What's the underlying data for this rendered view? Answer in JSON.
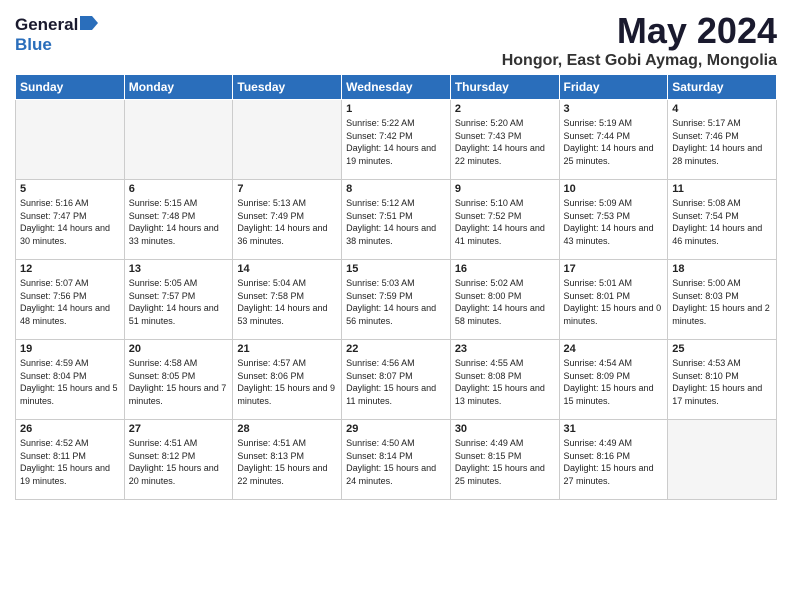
{
  "logo": {
    "general": "General",
    "blue": "Blue"
  },
  "title": {
    "month": "May 2024",
    "location": "Hongor, East Gobi Aymag, Mongolia"
  },
  "headers": [
    "Sunday",
    "Monday",
    "Tuesday",
    "Wednesday",
    "Thursday",
    "Friday",
    "Saturday"
  ],
  "weeks": [
    [
      {
        "day": "",
        "sunrise": "",
        "sunset": "",
        "daylight": "",
        "empty": true
      },
      {
        "day": "",
        "sunrise": "",
        "sunset": "",
        "daylight": "",
        "empty": true
      },
      {
        "day": "",
        "sunrise": "",
        "sunset": "",
        "daylight": "",
        "empty": true
      },
      {
        "day": "1",
        "sunrise": "Sunrise: 5:22 AM",
        "sunset": "Sunset: 7:42 PM",
        "daylight": "Daylight: 14 hours and 19 minutes."
      },
      {
        "day": "2",
        "sunrise": "Sunrise: 5:20 AM",
        "sunset": "Sunset: 7:43 PM",
        "daylight": "Daylight: 14 hours and 22 minutes."
      },
      {
        "day": "3",
        "sunrise": "Sunrise: 5:19 AM",
        "sunset": "Sunset: 7:44 PM",
        "daylight": "Daylight: 14 hours and 25 minutes."
      },
      {
        "day": "4",
        "sunrise": "Sunrise: 5:17 AM",
        "sunset": "Sunset: 7:46 PM",
        "daylight": "Daylight: 14 hours and 28 minutes."
      }
    ],
    [
      {
        "day": "5",
        "sunrise": "Sunrise: 5:16 AM",
        "sunset": "Sunset: 7:47 PM",
        "daylight": "Daylight: 14 hours and 30 minutes."
      },
      {
        "day": "6",
        "sunrise": "Sunrise: 5:15 AM",
        "sunset": "Sunset: 7:48 PM",
        "daylight": "Daylight: 14 hours and 33 minutes."
      },
      {
        "day": "7",
        "sunrise": "Sunrise: 5:13 AM",
        "sunset": "Sunset: 7:49 PM",
        "daylight": "Daylight: 14 hours and 36 minutes."
      },
      {
        "day": "8",
        "sunrise": "Sunrise: 5:12 AM",
        "sunset": "Sunset: 7:51 PM",
        "daylight": "Daylight: 14 hours and 38 minutes."
      },
      {
        "day": "9",
        "sunrise": "Sunrise: 5:10 AM",
        "sunset": "Sunset: 7:52 PM",
        "daylight": "Daylight: 14 hours and 41 minutes."
      },
      {
        "day": "10",
        "sunrise": "Sunrise: 5:09 AM",
        "sunset": "Sunset: 7:53 PM",
        "daylight": "Daylight: 14 hours and 43 minutes."
      },
      {
        "day": "11",
        "sunrise": "Sunrise: 5:08 AM",
        "sunset": "Sunset: 7:54 PM",
        "daylight": "Daylight: 14 hours and 46 minutes."
      }
    ],
    [
      {
        "day": "12",
        "sunrise": "Sunrise: 5:07 AM",
        "sunset": "Sunset: 7:56 PM",
        "daylight": "Daylight: 14 hours and 48 minutes."
      },
      {
        "day": "13",
        "sunrise": "Sunrise: 5:05 AM",
        "sunset": "Sunset: 7:57 PM",
        "daylight": "Daylight: 14 hours and 51 minutes."
      },
      {
        "day": "14",
        "sunrise": "Sunrise: 5:04 AM",
        "sunset": "Sunset: 7:58 PM",
        "daylight": "Daylight: 14 hours and 53 minutes."
      },
      {
        "day": "15",
        "sunrise": "Sunrise: 5:03 AM",
        "sunset": "Sunset: 7:59 PM",
        "daylight": "Daylight: 14 hours and 56 minutes."
      },
      {
        "day": "16",
        "sunrise": "Sunrise: 5:02 AM",
        "sunset": "Sunset: 8:00 PM",
        "daylight": "Daylight: 14 hours and 58 minutes."
      },
      {
        "day": "17",
        "sunrise": "Sunrise: 5:01 AM",
        "sunset": "Sunset: 8:01 PM",
        "daylight": "Daylight: 15 hours and 0 minutes."
      },
      {
        "day": "18",
        "sunrise": "Sunrise: 5:00 AM",
        "sunset": "Sunset: 8:03 PM",
        "daylight": "Daylight: 15 hours and 2 minutes."
      }
    ],
    [
      {
        "day": "19",
        "sunrise": "Sunrise: 4:59 AM",
        "sunset": "Sunset: 8:04 PM",
        "daylight": "Daylight: 15 hours and 5 minutes."
      },
      {
        "day": "20",
        "sunrise": "Sunrise: 4:58 AM",
        "sunset": "Sunset: 8:05 PM",
        "daylight": "Daylight: 15 hours and 7 minutes."
      },
      {
        "day": "21",
        "sunrise": "Sunrise: 4:57 AM",
        "sunset": "Sunset: 8:06 PM",
        "daylight": "Daylight: 15 hours and 9 minutes."
      },
      {
        "day": "22",
        "sunrise": "Sunrise: 4:56 AM",
        "sunset": "Sunset: 8:07 PM",
        "daylight": "Daylight: 15 hours and 11 minutes."
      },
      {
        "day": "23",
        "sunrise": "Sunrise: 4:55 AM",
        "sunset": "Sunset: 8:08 PM",
        "daylight": "Daylight: 15 hours and 13 minutes."
      },
      {
        "day": "24",
        "sunrise": "Sunrise: 4:54 AM",
        "sunset": "Sunset: 8:09 PM",
        "daylight": "Daylight: 15 hours and 15 minutes."
      },
      {
        "day": "25",
        "sunrise": "Sunrise: 4:53 AM",
        "sunset": "Sunset: 8:10 PM",
        "daylight": "Daylight: 15 hours and 17 minutes."
      }
    ],
    [
      {
        "day": "26",
        "sunrise": "Sunrise: 4:52 AM",
        "sunset": "Sunset: 8:11 PM",
        "daylight": "Daylight: 15 hours and 19 minutes."
      },
      {
        "day": "27",
        "sunrise": "Sunrise: 4:51 AM",
        "sunset": "Sunset: 8:12 PM",
        "daylight": "Daylight: 15 hours and 20 minutes."
      },
      {
        "day": "28",
        "sunrise": "Sunrise: 4:51 AM",
        "sunset": "Sunset: 8:13 PM",
        "daylight": "Daylight: 15 hours and 22 minutes."
      },
      {
        "day": "29",
        "sunrise": "Sunrise: 4:50 AM",
        "sunset": "Sunset: 8:14 PM",
        "daylight": "Daylight: 15 hours and 24 minutes."
      },
      {
        "day": "30",
        "sunrise": "Sunrise: 4:49 AM",
        "sunset": "Sunset: 8:15 PM",
        "daylight": "Daylight: 15 hours and 25 minutes."
      },
      {
        "day": "31",
        "sunrise": "Sunrise: 4:49 AM",
        "sunset": "Sunset: 8:16 PM",
        "daylight": "Daylight: 15 hours and 27 minutes."
      },
      {
        "day": "",
        "sunrise": "",
        "sunset": "",
        "daylight": "",
        "empty": true
      }
    ]
  ]
}
